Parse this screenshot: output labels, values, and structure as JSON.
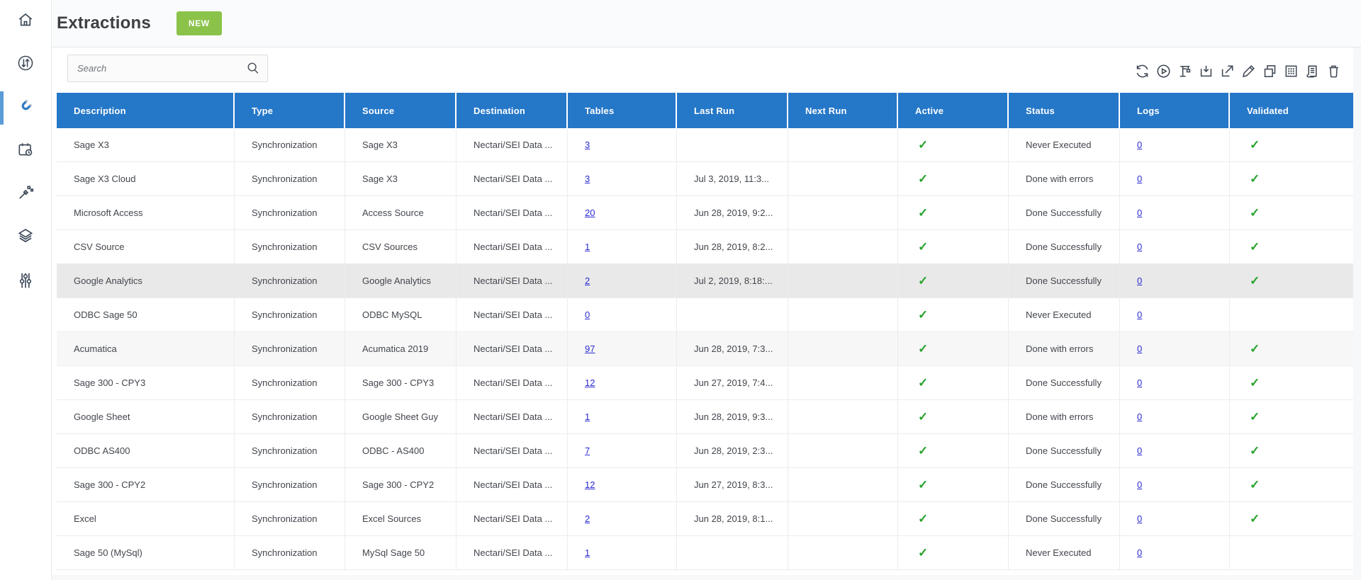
{
  "app": {
    "title": "Extractions",
    "new_button_label": "NEW"
  },
  "sidebar": {
    "items": [
      {
        "icon": "home-icon",
        "active": false
      },
      {
        "icon": "sync-arrows-icon",
        "active": false
      },
      {
        "icon": "magnet-icon",
        "active": true
      },
      {
        "icon": "calendar-schedule-icon",
        "active": false
      },
      {
        "icon": "magic-wand-icon",
        "active": false
      },
      {
        "icon": "layers-icon",
        "active": false
      },
      {
        "icon": "sliders-icon",
        "active": false
      }
    ]
  },
  "search": {
    "placeholder": "Search"
  },
  "toolbar": {
    "icons": [
      "refresh-icon",
      "run-icon",
      "crane-icon",
      "download-icon",
      "export-icon",
      "edit-icon",
      "copy-icon",
      "grid-icon",
      "logs-doc-icon",
      "delete-icon"
    ]
  },
  "table": {
    "columns": [
      "Description",
      "Type",
      "Source",
      "Destination",
      "Tables",
      "Last Run",
      "Next Run",
      "Active",
      "Status",
      "Logs",
      "Validated"
    ],
    "rows": [
      {
        "description": "Sage X3",
        "type": "Synchronization",
        "source": "Sage X3",
        "destination": "Nectari/SEI Data ...",
        "tables": "3",
        "last_run": "",
        "next_run": "",
        "active": true,
        "status": "Never Executed",
        "logs": "0",
        "validated": true,
        "highlight": ""
      },
      {
        "description": "Sage X3 Cloud",
        "type": "Synchronization",
        "source": "Sage X3",
        "destination": "Nectari/SEI Data ...",
        "tables": "3",
        "last_run": "Jul 3, 2019, 11:3...",
        "next_run": "",
        "active": true,
        "status": "Done with errors",
        "logs": "0",
        "validated": true,
        "highlight": ""
      },
      {
        "description": "Microsoft Access",
        "type": "Synchronization",
        "source": "Access Source",
        "destination": "Nectari/SEI Data ...",
        "tables": "20",
        "last_run": "Jun 28, 2019, 9:2...",
        "next_run": "",
        "active": true,
        "status": "Done Successfully",
        "logs": "0",
        "validated": true,
        "highlight": ""
      },
      {
        "description": "CSV Source",
        "type": "Synchronization",
        "source": "CSV Sources",
        "destination": "Nectari/SEI Data ...",
        "tables": "1",
        "last_run": "Jun 28, 2019, 8:2...",
        "next_run": "",
        "active": true,
        "status": "Done Successfully",
        "logs": "0",
        "validated": true,
        "highlight": ""
      },
      {
        "description": "Google Analytics",
        "type": "Synchronization",
        "source": "Google Analytics",
        "destination": "Nectari/SEI Data ...",
        "tables": "2",
        "last_run": "Jul 2, 2019, 8:18:...",
        "next_run": "",
        "active": true,
        "status": "Done Successfully",
        "logs": "0",
        "validated": true,
        "highlight": "selected"
      },
      {
        "description": "ODBC Sage 50",
        "type": "Synchronization",
        "source": "ODBC MySQL",
        "destination": "Nectari/SEI Data ...",
        "tables": "0",
        "last_run": "",
        "next_run": "",
        "active": true,
        "status": "Never Executed",
        "logs": "0",
        "validated": false,
        "highlight": ""
      },
      {
        "description": "Acumatica",
        "type": "Synchronization",
        "source": "Acumatica 2019",
        "destination": "Nectari/SEI Data ...",
        "tables": "97",
        "last_run": "Jun 28, 2019, 7:3...",
        "next_run": "",
        "active": true,
        "status": "Done with errors",
        "logs": "0",
        "validated": true,
        "highlight": "subtle"
      },
      {
        "description": "Sage 300 - CPY3",
        "type": "Synchronization",
        "source": "Sage 300 - CPY3",
        "destination": "Nectari/SEI Data ...",
        "tables": "12",
        "last_run": "Jun 27, 2019, 7:4...",
        "next_run": "",
        "active": true,
        "status": "Done Successfully",
        "logs": "0",
        "validated": true,
        "highlight": ""
      },
      {
        "description": "Google Sheet",
        "type": "Synchronization",
        "source": "Google Sheet Guy",
        "destination": "Nectari/SEI Data ...",
        "tables": "1",
        "last_run": "Jun 28, 2019, 9:3...",
        "next_run": "",
        "active": true,
        "status": "Done with errors",
        "logs": "0",
        "validated": true,
        "highlight": ""
      },
      {
        "description": "ODBC AS400",
        "type": "Synchronization",
        "source": "ODBC - AS400",
        "destination": "Nectari/SEI Data ...",
        "tables": "7",
        "last_run": "Jun 28, 2019, 2:3...",
        "next_run": "",
        "active": true,
        "status": "Done Successfully",
        "logs": "0",
        "validated": true,
        "highlight": ""
      },
      {
        "description": "Sage 300 - CPY2",
        "type": "Synchronization",
        "source": "Sage 300 - CPY2",
        "destination": "Nectari/SEI Data ...",
        "tables": "12",
        "last_run": "Jun 27, 2019, 8:3...",
        "next_run": "",
        "active": true,
        "status": "Done Successfully",
        "logs": "0",
        "validated": true,
        "highlight": ""
      },
      {
        "description": "Excel",
        "type": "Synchronization",
        "source": "Excel Sources",
        "destination": "Nectari/SEI Data ...",
        "tables": "2",
        "last_run": "Jun 28, 2019, 8:1...",
        "next_run": "",
        "active": true,
        "status": "Done Successfully",
        "logs": "0",
        "validated": true,
        "highlight": ""
      },
      {
        "description": "Sage 50 (MySql)",
        "type": "Synchronization",
        "source": "MySql Sage 50",
        "destination": "Nectari/SEI Data ...",
        "tables": "1",
        "last_run": "",
        "next_run": "",
        "active": true,
        "status": "Never Executed",
        "logs": "0",
        "validated": false,
        "highlight": ""
      }
    ]
  },
  "colors": {
    "header_blue": "#2577c8",
    "accent_green": "#8bc34a",
    "check_green": "#27a22b",
    "link_blue": "#2a2ad2",
    "active_bar_blue": "#5b9bd8",
    "selected_row": "#e9e9e9",
    "hover_row": "#f7f7f7"
  }
}
